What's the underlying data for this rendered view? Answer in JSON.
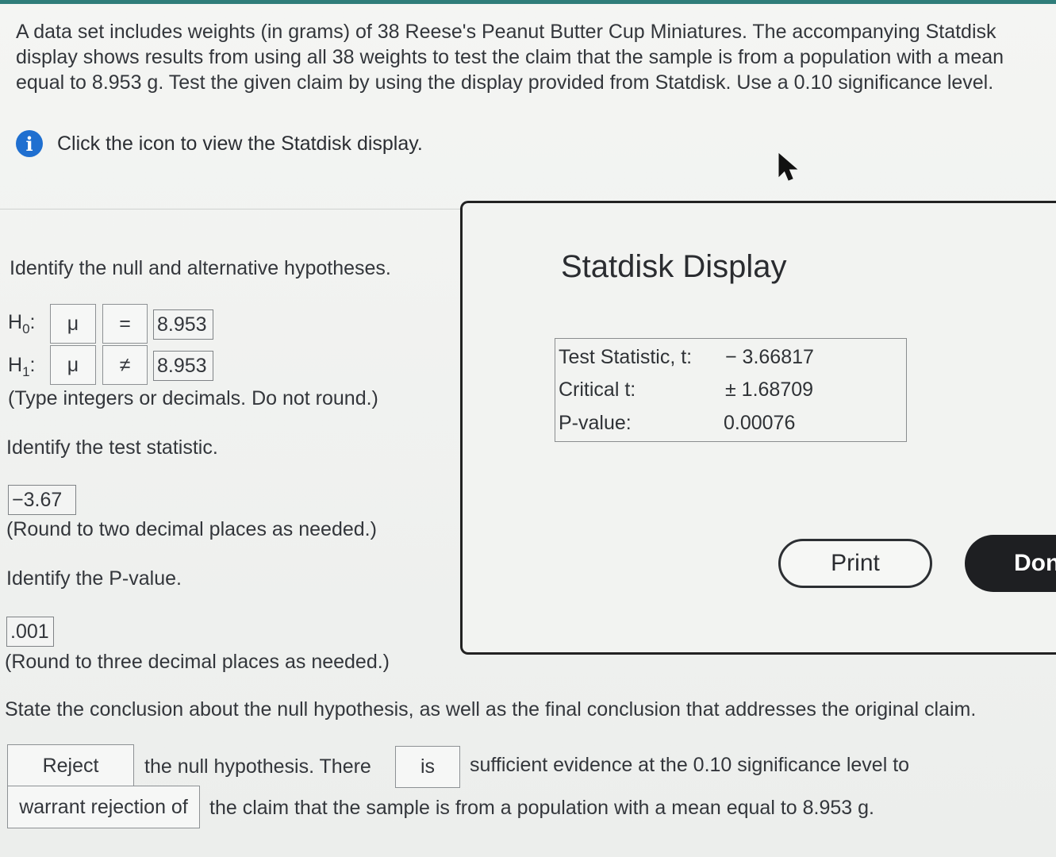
{
  "problem": {
    "text": "A data set includes weights (in grams) of 38 Reese's Peanut Butter Cup Miniatures. The accompanying Statdisk display shows results from using all 38 weights to test the claim that the sample is from a population with a mean equal to 8.953 g. Test the given claim by using the display provided from Statdisk. Use a 0.10 significance level.",
    "info_link": "Click the icon to view the Statdisk display."
  },
  "hypotheses": {
    "prompt": "Identify the null and alternative hypotheses.",
    "h0": {
      "label": "H",
      "sub": "0",
      "param": "μ",
      "op": "=",
      "value": "8.953"
    },
    "h1": {
      "label": "H",
      "sub": "1",
      "param": "μ",
      "op": "≠",
      "value": "8.953"
    },
    "note": "(Type integers or decimals. Do not round.)"
  },
  "test_statistic": {
    "prompt": "Identify the test statistic.",
    "answer": "−3.67",
    "note": "(Round to two decimal places as needed.)"
  },
  "p_value": {
    "prompt": "Identify the P-value.",
    "answer": ".001",
    "note": "(Round to three decimal places as needed.)"
  },
  "conclusion": {
    "prompt": "State the conclusion about the null hypothesis, as well as the final conclusion that addresses the original claim.",
    "choice1": "Reject",
    "text1": "the null hypothesis. There",
    "choice2": "is",
    "text2": "sufficient evidence at the 0.10 significance level to",
    "choice3": "warrant rejection of",
    "text3": "the claim that the sample is from a population with a mean equal to 8.953 g."
  },
  "modal": {
    "title": "Statdisk Display",
    "rows": [
      {
        "label": "Test Statistic, t:",
        "value": "− 3.66817"
      },
      {
        "label": "Critical t:",
        "value": "± 1.68709"
      },
      {
        "label": "P-value:",
        "value": "0.00076"
      }
    ],
    "print_label": "Print",
    "done_label": "Don"
  },
  "colors": {
    "info_icon": "#1f6fd0",
    "done_button": "#1e1f22"
  }
}
